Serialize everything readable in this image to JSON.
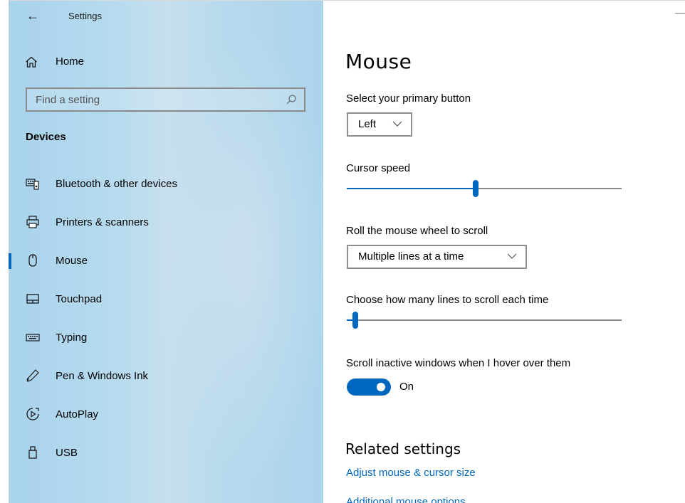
{
  "window": {
    "title": "Settings"
  },
  "sidebar": {
    "home_label": "Home",
    "search_placeholder": "Find a setting",
    "section_title": "Devices",
    "items": [
      {
        "label": "Bluetooth & other devices",
        "icon": "keyboard-phone-icon"
      },
      {
        "label": "Printers & scanners",
        "icon": "printer-icon"
      },
      {
        "label": "Mouse",
        "icon": "mouse-icon",
        "active": true
      },
      {
        "label": "Touchpad",
        "icon": "touchpad-icon"
      },
      {
        "label": "Typing",
        "icon": "keyboard-icon"
      },
      {
        "label": "Pen & Windows Ink",
        "icon": "pen-icon"
      },
      {
        "label": "AutoPlay",
        "icon": "autoplay-icon"
      },
      {
        "label": "USB",
        "icon": "usb-icon"
      }
    ]
  },
  "main": {
    "title": "Mouse",
    "primary_button": {
      "label": "Select your primary button",
      "value": "Left"
    },
    "cursor_speed": {
      "label": "Cursor speed",
      "level": 0.47
    },
    "scroll_mode": {
      "label": "Roll the mouse wheel to scroll",
      "value": "Multiple lines at a time"
    },
    "scroll_lines": {
      "label": "Choose how many lines to scroll each time",
      "level": 0.03
    },
    "inactive_scroll": {
      "label": "Scroll inactive windows when I hover over them",
      "state": "On"
    },
    "related": {
      "title": "Related settings",
      "links": [
        "Adjust mouse & cursor size",
        "Additional mouse options"
      ]
    }
  },
  "colors": {
    "accent": "#0067c0",
    "sidebar_bg": "#b7dbef",
    "track_inactive": "#8a8a8a"
  }
}
